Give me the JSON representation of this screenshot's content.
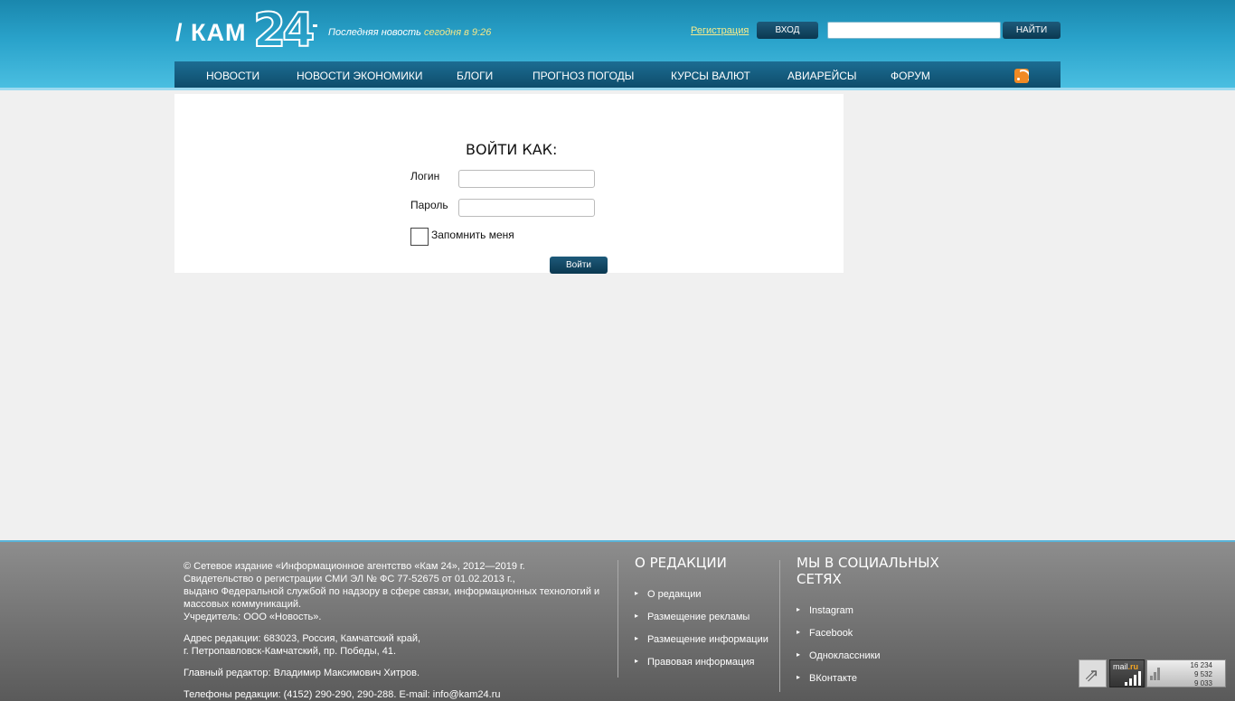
{
  "header": {
    "logo_text": "/ КАМ",
    "logo_number": "24",
    "latest_prefix": "Последняя новость",
    "latest_time": "сегодня в 9:26",
    "register_link": "Регистрация",
    "login_button": "ВХОД",
    "search_placeholder": "",
    "search_button": "НАЙТИ"
  },
  "nav": {
    "items": [
      "НОВОСТИ",
      "НОВОСТИ ЭКОНОМИКИ",
      "БЛОГИ",
      "ПРОГНОЗ ПОГОДЫ",
      "КУРСЫ ВАЛЮТ",
      "АВИАРЕЙСЫ",
      "ФОРУМ"
    ],
    "rss_icon": "rss-icon"
  },
  "login_form": {
    "title": "ВОЙТИ КАК:",
    "login_label": "Логин",
    "login_value": "",
    "password_label": "Пароль",
    "password_value": "",
    "remember_label": "Запомнить меня",
    "remember_checked": false,
    "submit_label": "Войти"
  },
  "footer": {
    "copyright": [
      "© Сетевое издание «Информационное агентство «Кам 24», 2012—2019 г.",
      "Свидетельство о регистрации СМИ ЭЛ № ФС 77-52675 от 01.02.2013 г.,",
      "выдано Федеральной службой по надзору в сфере связи, информационных технологий и",
      "массовых коммуникаций.",
      "Учредитель: ООО «Новость»."
    ],
    "address": [
      "Адрес редакции: 683023, Россия, Камчатский край,",
      "г. Петропавловск-Камчатский, пр. Победы, 41."
    ],
    "editor": "Главный редактор: Владимир Максимович Хитров.",
    "phones_prefix": "Телефоны редакции: (4152) 290-290, 290-288. E-mail:",
    "email": "info@kam24.ru",
    "about_heading": "О РЕДАКЦИИ",
    "about_links": [
      "О редакции",
      "Размещение рекламы",
      "Размещение информации",
      "Правовая информация"
    ],
    "social_heading_1": "МЫ В СОЦИАЛЬНЫХ",
    "social_heading_2": "СЕТЯХ",
    "social_links": [
      "Instagram",
      "Facebook",
      "Одноклассники",
      "ВКонтакте"
    ]
  },
  "counters": {
    "mail_label_1": "mail",
    "mail_label_2": ".ru",
    "values": [
      "16 234",
      "9 532",
      "9 033"
    ]
  }
}
